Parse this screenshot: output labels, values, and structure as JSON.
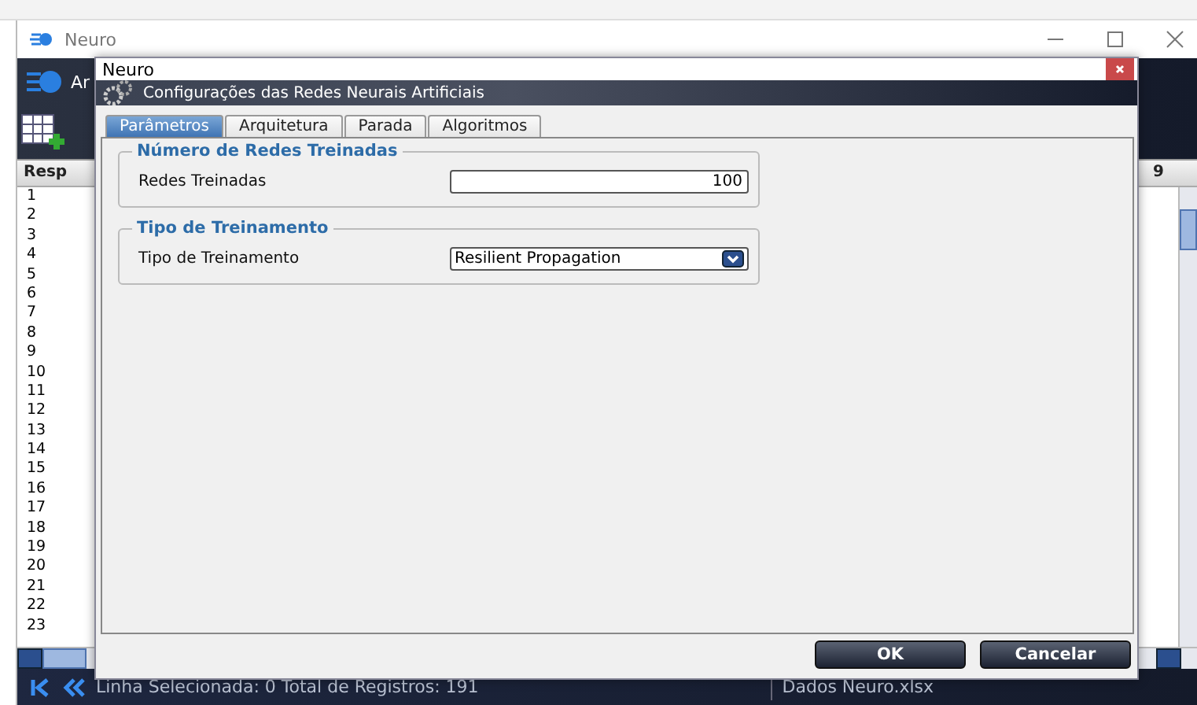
{
  "app": {
    "title": "Neuro",
    "header_title": "Ar",
    "table": {
      "columns": [
        "Resp",
        "9"
      ],
      "rows": [
        "1",
        "2",
        "3",
        "4",
        "5",
        "6",
        "7",
        "8",
        "9",
        "10",
        "11",
        "12",
        "13",
        "14",
        "15",
        "16",
        "17",
        "18",
        "19",
        "20",
        "21",
        "22",
        "23"
      ]
    },
    "status_bar": {
      "text": "Linha Selecionada: 0  Total de Registros: 191",
      "file": "Dados Neuro.xlsx"
    }
  },
  "dialog": {
    "title": "Neuro",
    "header": "Configurações das Redes Neurais Artificiais",
    "tabs": [
      {
        "label": "Parâmetros",
        "selected": true
      },
      {
        "label": "Arquitetura",
        "selected": false
      },
      {
        "label": "Parada",
        "selected": false
      },
      {
        "label": "Algoritmos",
        "selected": false
      }
    ],
    "groups": [
      {
        "title": "Número de Redes Treinadas",
        "kind": "input",
        "label": "Redes Treinadas",
        "value": "100"
      },
      {
        "title": "Tipo de Treinamento",
        "kind": "select",
        "label": "Tipo de Treinamento",
        "value": "Resilient Propagation"
      }
    ],
    "buttons": [
      "OK",
      "Cancelar"
    ]
  }
}
